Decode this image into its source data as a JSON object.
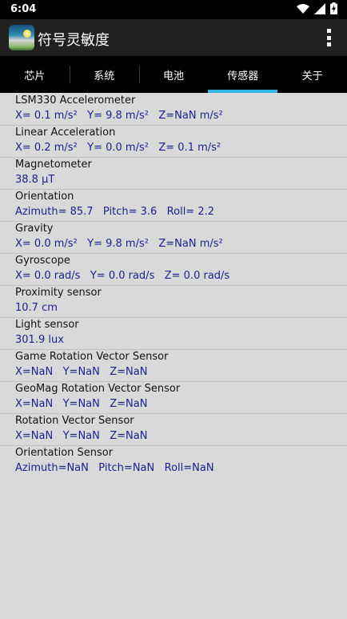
{
  "status": {
    "time": "6:04"
  },
  "app": {
    "title": "符号灵敏度"
  },
  "tabs": [
    {
      "label": "芯片"
    },
    {
      "label": "系统"
    },
    {
      "label": "电池"
    },
    {
      "label": "传感器"
    },
    {
      "label": "关于"
    }
  ],
  "active_tab": "传感器",
  "sensors": [
    {
      "name": "LSM330 Accelerometer",
      "value": "X= 0.1 m/s²   Y= 9.8 m/s²   Z=NaN m/s²"
    },
    {
      "name": "Linear Acceleration",
      "value": "X= 0.2 m/s²   Y= 0.0 m/s²   Z= 0.1 m/s²"
    },
    {
      "name": "Magnetometer",
      "value": "38.8 μT"
    },
    {
      "name": "Orientation",
      "value": "Azimuth= 85.7   Pitch= 3.6   Roll= 2.2"
    },
    {
      "name": "Gravity",
      "value": "X= 0.0 m/s²   Y= 9.8 m/s²   Z=NaN m/s²"
    },
    {
      "name": "Gyroscope",
      "value": "X= 0.0 rad/s   Y= 0.0 rad/s   Z= 0.0 rad/s"
    },
    {
      "name": "Proximity sensor",
      "value": "10.7 cm"
    },
    {
      "name": "Light sensor",
      "value": "301.9 lux"
    },
    {
      "name": "Game Rotation Vector Sensor",
      "value": "X=NaN   Y=NaN   Z=NaN"
    },
    {
      "name": "GeoMag Rotation Vector Sensor",
      "value": "X=NaN   Y=NaN   Z=NaN"
    },
    {
      "name": "Rotation Vector Sensor",
      "value": "X=NaN   Y=NaN   Z=NaN"
    },
    {
      "name": "Orientation Sensor",
      "value": "Azimuth=NaN   Pitch=NaN   Roll=NaN"
    }
  ],
  "icons": {
    "wifi": "wifi-icon",
    "signal": "cell-signal-icon",
    "battery": "battery-charging-icon",
    "overflow": "more-vert-icon"
  },
  "colors": {
    "accent": "#33b5e5",
    "value_text": "#1b1f8f",
    "background": "#d9d9d9"
  }
}
